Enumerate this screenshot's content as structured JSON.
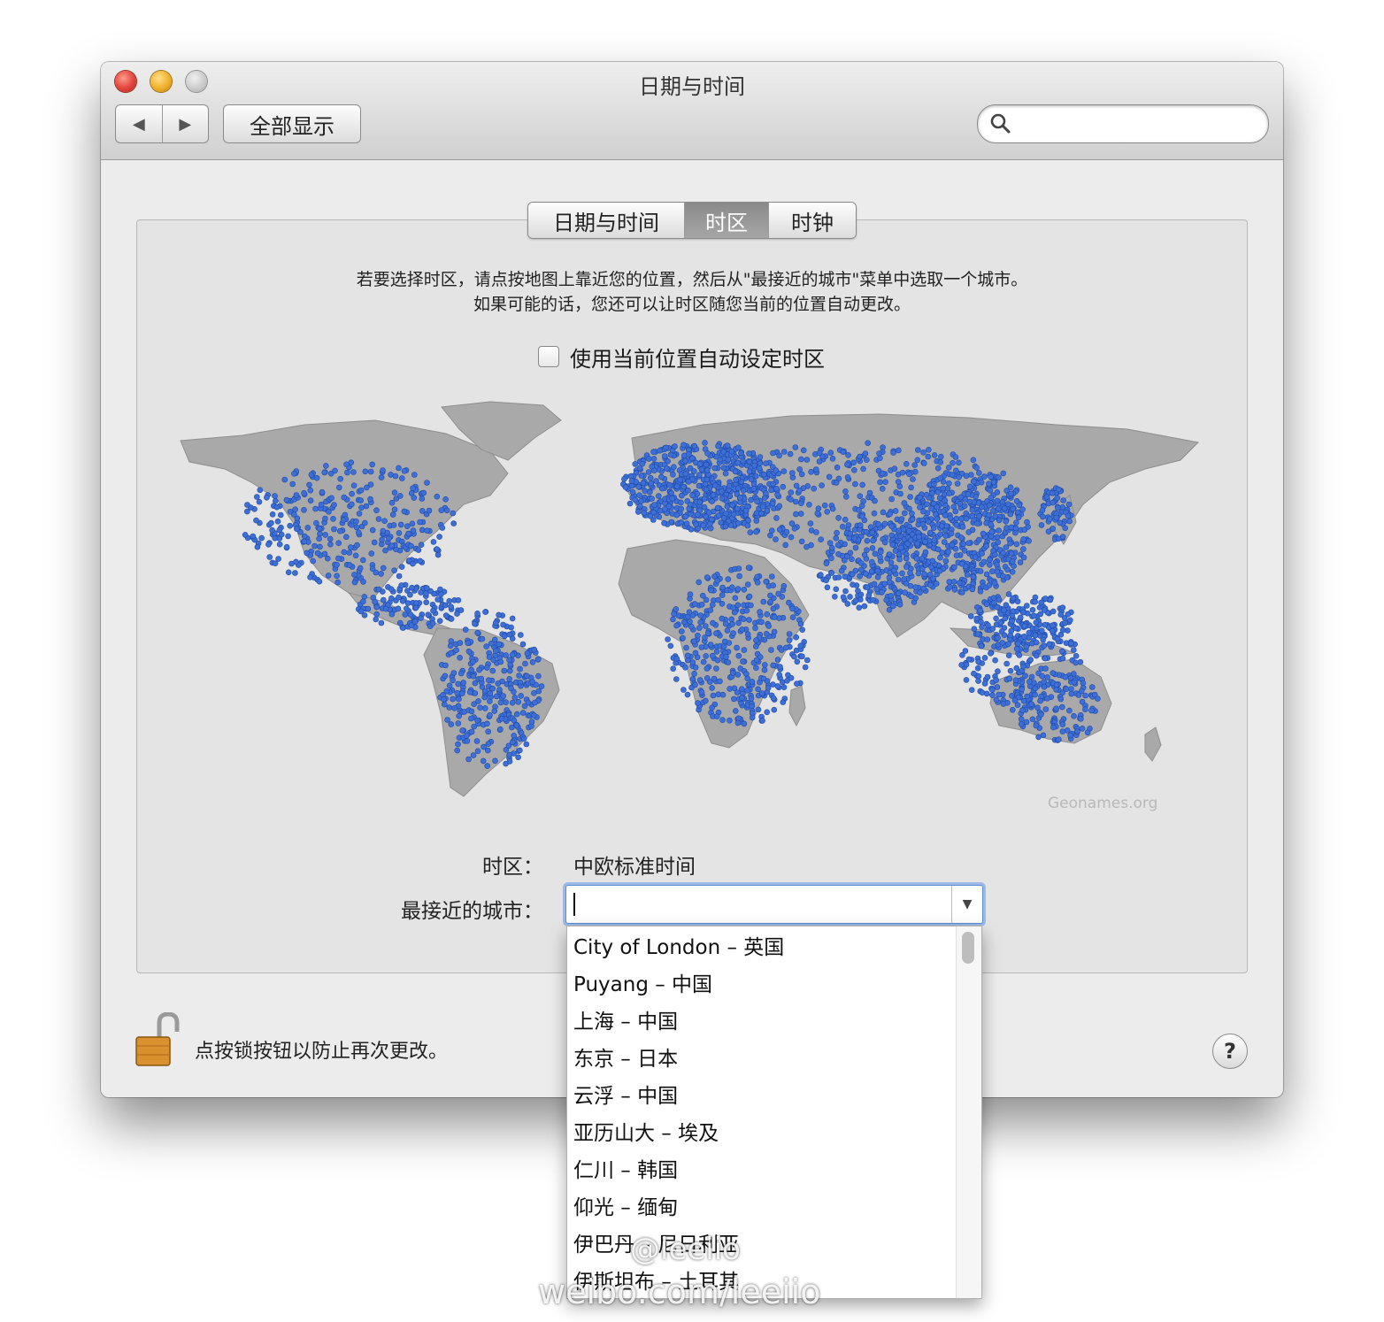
{
  "window": {
    "title": "日期与时间",
    "show_all_label": "全部显示",
    "back_glyph": "◀",
    "forward_glyph": "▶",
    "search_placeholder": ""
  },
  "tabs": [
    {
      "label": "日期与时间",
      "active": false
    },
    {
      "label": "时区",
      "active": true
    },
    {
      "label": "时钟",
      "active": false
    }
  ],
  "instructions": {
    "line1": "若要选择时区，请点按地图上靠近您的位置，然后从\"最接近的城市\"菜单中选取一个城市。",
    "line2": "如果可能的话，您还可以让时区随您当前的位置自动更改。"
  },
  "auto_timezone": {
    "label": "使用当前位置自动设定时区",
    "checked": false
  },
  "map": {
    "credit": "Geonames.org",
    "land_color": "#a9a9a9",
    "dot_color": "#3d6fd6"
  },
  "form": {
    "timezone_label": "时区：",
    "timezone_value": "中欧标准时间",
    "city_label": "最接近的城市：",
    "city_value": ""
  },
  "city_options": [
    "City of London – 英国",
    "Puyang – 中国",
    "上海 – 中国",
    "东京 – 日本",
    "云浮 – 中国",
    "亚历山大 – 埃及",
    "仁川 – 韩国",
    "仰光 – 缅甸",
    "伊巴丹 – 尼日利亚",
    "伊斯坦布 – 土耳其"
  ],
  "lock": {
    "text": "点按锁按钮以防止再次更改。"
  },
  "help": {
    "label": "?"
  },
  "watermark": {
    "line1": "@leeiio",
    "line2": "weibo.com/leeiio"
  }
}
